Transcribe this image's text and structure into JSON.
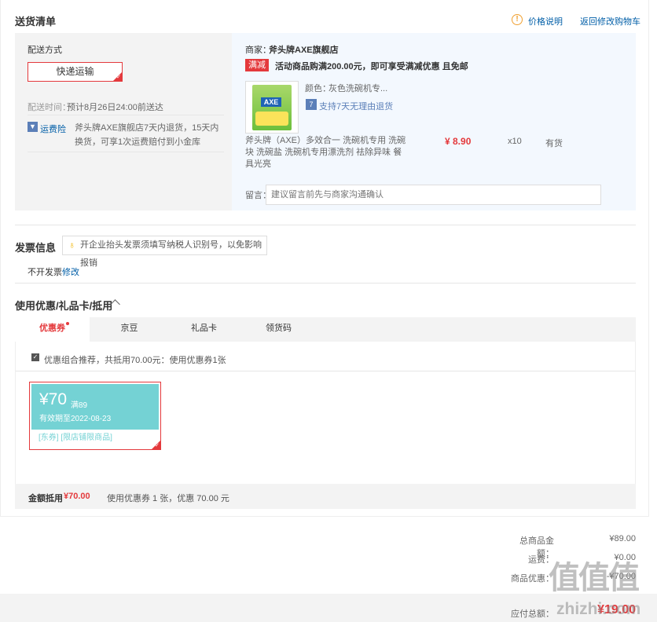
{
  "delivery": {
    "title": "送货清单",
    "price_info_label": "价格说明",
    "back_to_cart_label": "返回修改购物车",
    "method_title": "配送方式",
    "method_button": "快递运输",
    "time_label": "配送时间：",
    "time_value": "预计8月26日24:00前送达",
    "insurance_label": "运费险",
    "insurance_text": "斧头牌AXE旗舰店7天内退货，15天内换货，可享1次运费赔付到小金库"
  },
  "shop": {
    "seller_label": "商家：",
    "seller_name": "斧头牌AXE旗舰店",
    "promo_tag": "满减",
    "promo_text": "活动商品购满200.00元，即可享受满减优惠 且免邮",
    "product": {
      "color_label": "颜色：",
      "color_value": "灰色洗碗机专...",
      "return_tag": "7",
      "return_text": "支持7天无理由退货",
      "name": "斧头牌（AXE）多效合一 洗碗机专用 洗碗块 洗碗盐 洗碗机专用漂洗剂 祛除异味 餐具光亮",
      "price": "¥ 8.90",
      "quantity": "x10",
      "stock": "有货",
      "brand_mark": "AXE"
    },
    "remark_label": "留言：",
    "remark_placeholder": "建议留言前先与商家沟通确认"
  },
  "invoice": {
    "title": "发票信息",
    "tip": "开企业抬头发票须填写纳税人识别号，以免影响报销",
    "value": "不开发票",
    "edit_label": "修改"
  },
  "discount": {
    "title": "使用优惠/礼品卡/抵用",
    "tabs": [
      {
        "label": "优惠券"
      },
      {
        "label": "京豆"
      },
      {
        "label": "礼品卡"
      },
      {
        "label": "领货码"
      }
    ],
    "combo_text": "优惠组合推荐，共抵用70.00元：使用优惠券1张",
    "coupon": {
      "amount": "¥70",
      "condition": "满89",
      "validity": "有效期至2022-08-23",
      "scope": "[东券] [限店铺限商品]"
    },
    "deduct_label": "金额抵用",
    "deduct_value": "¥70.00",
    "deduct_detail": "使用优惠券 1 张，优惠 70.00 元"
  },
  "summary": {
    "total_label": "总商品金额：",
    "total_value": "¥89.00",
    "shipping_label": "运费：",
    "shipping_value": "¥0.00",
    "discount_label": "商品优惠：",
    "discount_value": "-¥70.00",
    "payable_label": "应付总额：",
    "payable_value": "¥19.00"
  },
  "watermark": {
    "glyphs": "值值值",
    "site": "zhizhi.com"
  },
  "colors": {
    "accent": "#e4393c",
    "link": "#005ea7",
    "coupon": "#74d2d4"
  }
}
